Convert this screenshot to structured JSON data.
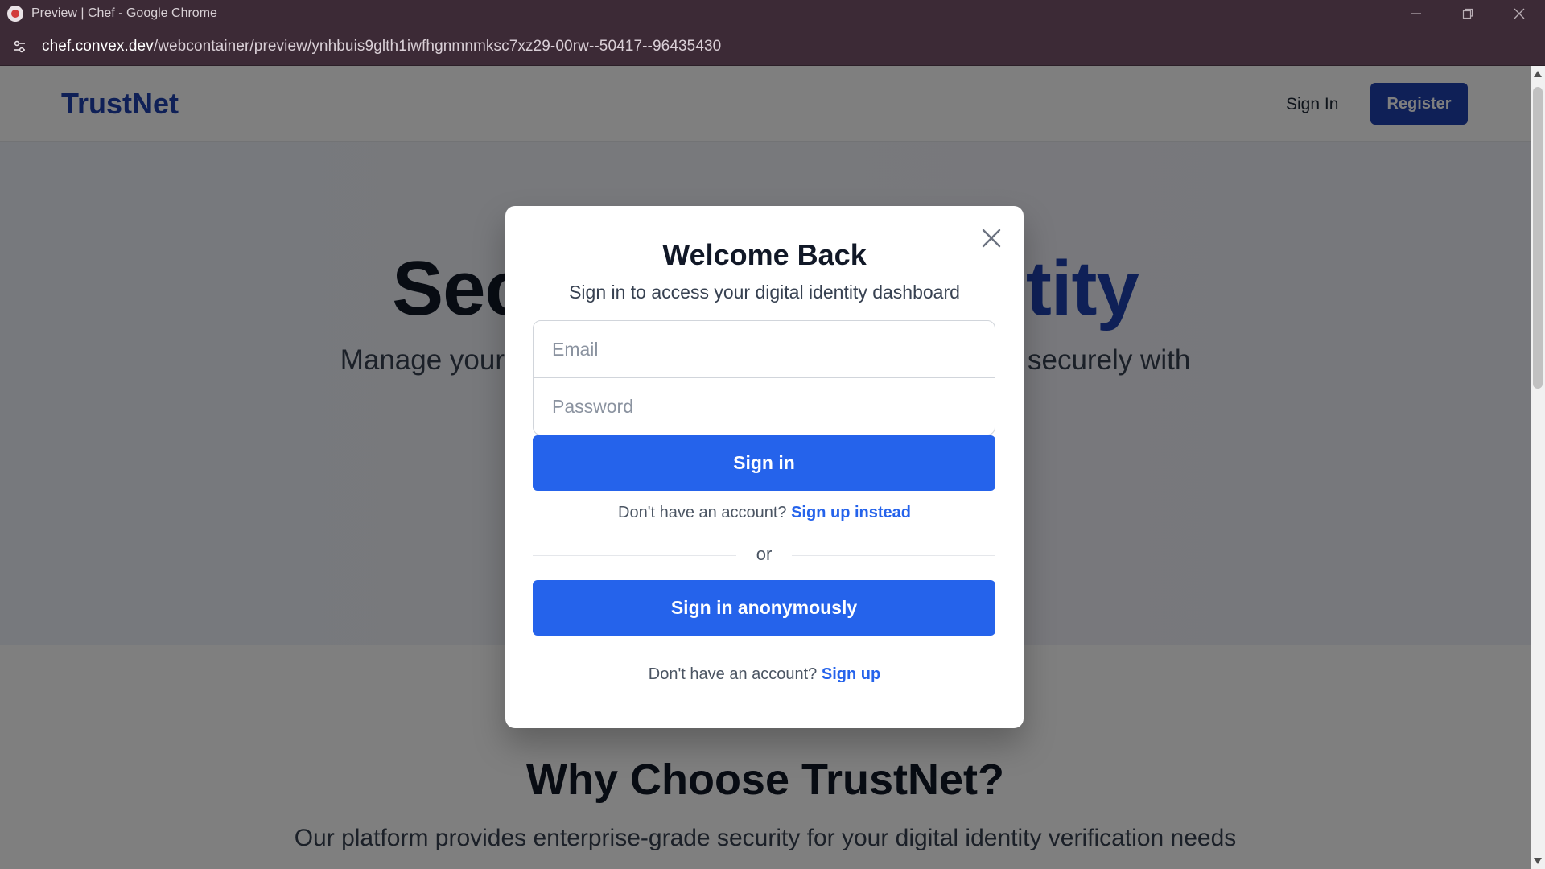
{
  "browser": {
    "window_title": "Preview | Chef - Google Chrome",
    "url_host": "chef.convex.dev",
    "url_path": "/webcontainer/preview/ynhbuis9glth1iwfhgnmnmksc7xz29-00rw--50417--96435430"
  },
  "header": {
    "logo": "TrustNet",
    "signin_label": "Sign In",
    "register_label": "Register"
  },
  "hero": {
    "title_left": "Sec",
    "title_right": "tity",
    "subtitle_left": "Manage your",
    "subtitle_right": "securely with"
  },
  "why": {
    "title": "Why Choose TrustNet?",
    "subtitle": "Our platform provides enterprise-grade security for your digital identity verification needs"
  },
  "modal": {
    "title": "Welcome Back",
    "subtitle": "Sign in to access your digital identity dashboard",
    "email_placeholder": "Email",
    "password_placeholder": "Password",
    "signin_button": "Sign in",
    "no_account_text": "Don't have an account?",
    "signup_instead_link": "Sign up instead",
    "divider_text": "or",
    "anon_button": "Sign in anonymously",
    "no_account_text_2": "Don't have an account?",
    "signup_link": "Sign up"
  },
  "colors": {
    "brand": "#1e40af",
    "primary_button": "#2563eb",
    "browser_chrome": "#3c2a36"
  }
}
